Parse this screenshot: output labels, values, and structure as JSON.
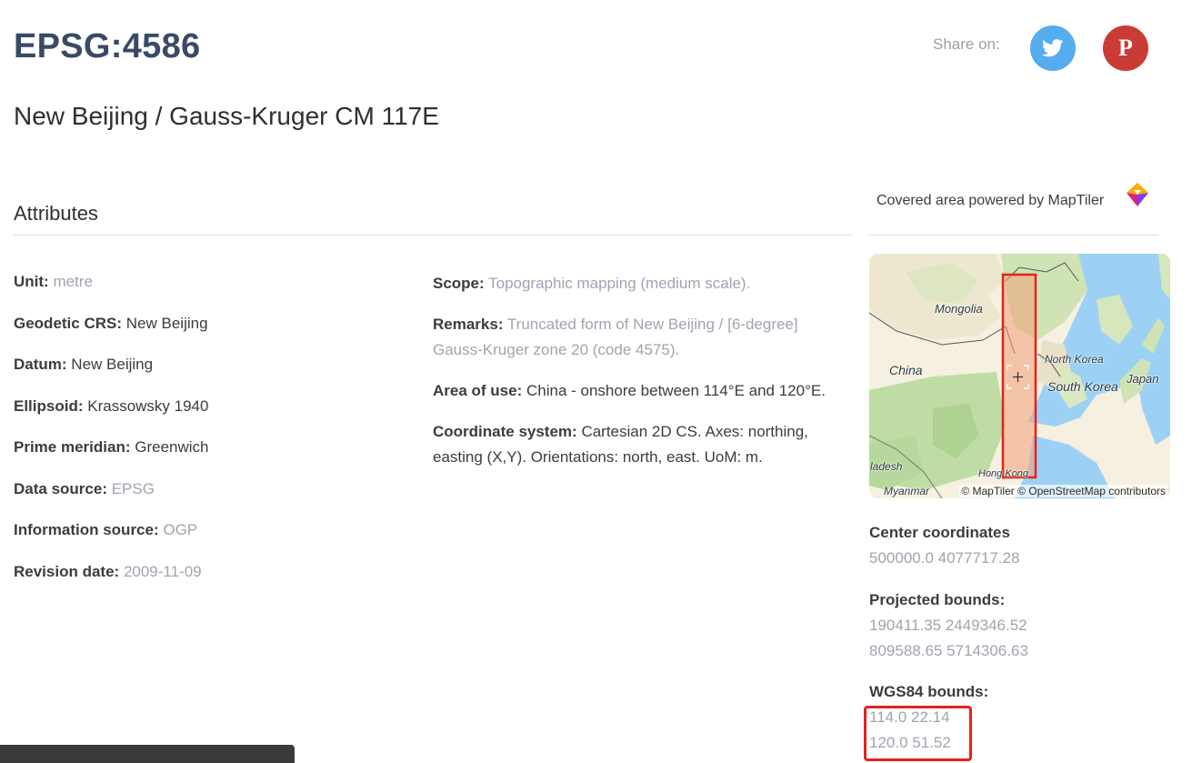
{
  "header": {
    "title": "EPSG:4586",
    "subtitle": "New Beijing / Gauss-Kruger CM 117E"
  },
  "share": {
    "label": "Share on:",
    "twitter_icon": "twitter-icon",
    "pinterest_icon": "pinterest-icon",
    "twitter_color": "#55acee",
    "pinterest_color": "#cb3b35"
  },
  "attributes": {
    "heading": "Attributes",
    "left": [
      {
        "label": "Unit:",
        "value": "metre",
        "muted": true
      },
      {
        "label": "Geodetic CRS:",
        "value": "New Beijing",
        "muted": false
      },
      {
        "label": "Datum:",
        "value": "New Beijing",
        "muted": false
      },
      {
        "label": "Ellipsoid:",
        "value": "Krassowsky 1940",
        "muted": false
      },
      {
        "label": "Prime meridian:",
        "value": "Greenwich",
        "muted": false
      },
      {
        "label": "Data source:",
        "value": "EPSG",
        "muted": true
      },
      {
        "label": "Information source:",
        "value": "OGP",
        "muted": true
      },
      {
        "label": "Revision date:",
        "value": "2009-11-09",
        "muted": true
      }
    ],
    "middle": [
      {
        "label": "Scope:",
        "value": "Topographic mapping (medium scale).",
        "muted": true
      },
      {
        "label": "Remarks:",
        "value": "Truncated form of New Beijing / [6-degree] Gauss-Kruger zone 20 (code 4575).",
        "muted": true
      },
      {
        "label": "Area of use:",
        "value": "China - onshore between 114°E and 120°E.",
        "muted": false
      },
      {
        "label": "Coordinate system:",
        "value": "Cartesian 2D CS. Axes: northing, easting (X,Y). Orientations: north, east. UoM: m.",
        "muted": false
      }
    ]
  },
  "coverage": {
    "heading": "Covered area powered by MapTiler",
    "logo_icon": "maptiler-logo-icon",
    "map": {
      "labels": {
        "mongolia": "Mongolia",
        "china": "China",
        "north_korea": "North Korea",
        "south_korea": "South Korea",
        "japan": "Japan",
        "hong_kong": "Hong Kong",
        "bangladesh": "ladesh",
        "myanmar": "Myanmar"
      },
      "attribution": "© MapTiler © OpenStreetMap contributors",
      "highlight_color": "#e2231a"
    },
    "center": {
      "label": "Center coordinates",
      "value": "500000.0 4077717.28"
    },
    "projected": {
      "label": "Projected bounds:",
      "line1": "190411.35 2449346.52",
      "line2": "809588.65 5714306.63"
    },
    "wgs84": {
      "label": "WGS84 bounds:",
      "line1": "114.0 22.14",
      "line2": "120.0 51.52"
    }
  }
}
